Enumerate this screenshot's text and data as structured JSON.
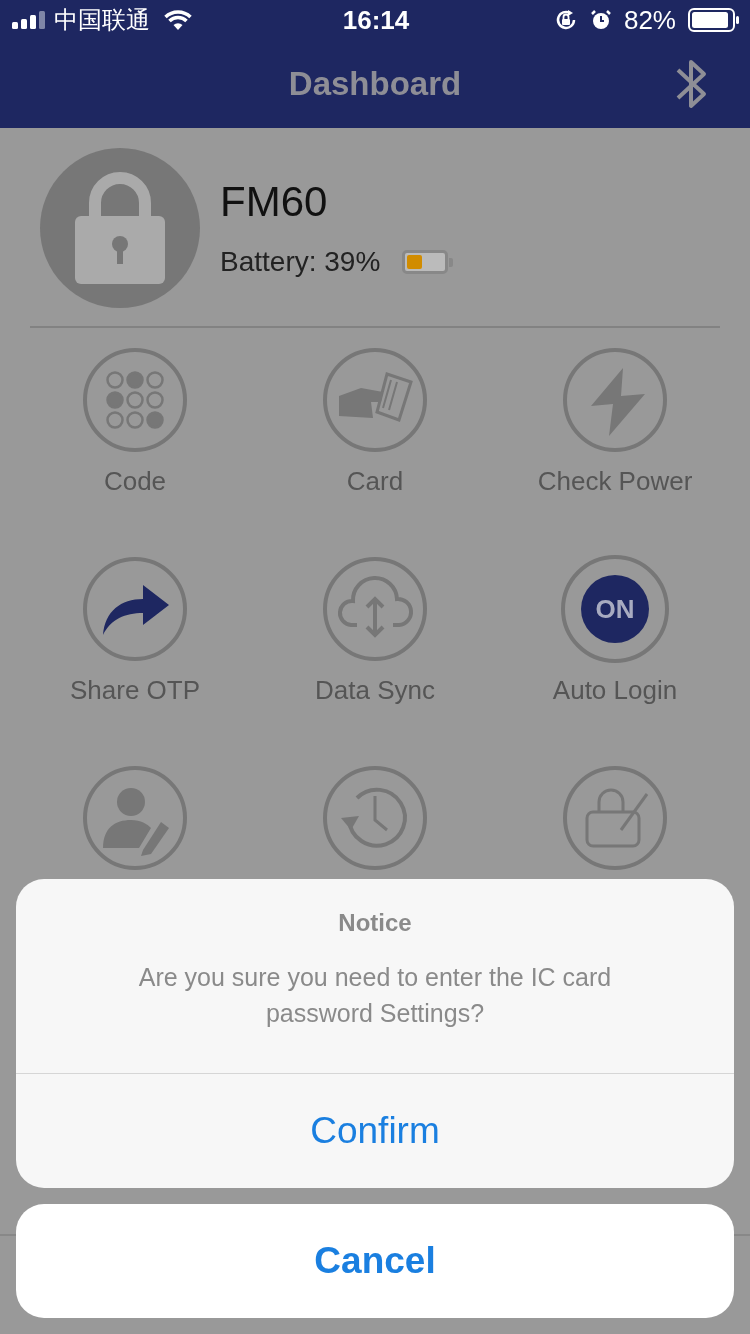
{
  "status_bar": {
    "carrier": "中国联通",
    "time": "16:14",
    "battery": "82%"
  },
  "header": {
    "title": "Dashboard"
  },
  "device": {
    "name": "FM60",
    "battery": "Battery: 39%"
  },
  "tiles": [
    {
      "kind": "code",
      "label": "Code"
    },
    {
      "kind": "card",
      "label": "Card"
    },
    {
      "kind": "power",
      "label": "Check Power"
    },
    {
      "kind": "share",
      "label": "Share OTP"
    },
    {
      "kind": "sync",
      "label": "Data Sync"
    },
    {
      "kind": "on",
      "label": "Auto Login",
      "badge": "ON"
    },
    {
      "kind": "user"
    },
    {
      "kind": "history"
    },
    {
      "kind": "password"
    }
  ],
  "dialog": {
    "title": "Notice",
    "message": "Are you sure you need to enter the IC card password Settings?",
    "confirm": "Confirm",
    "cancel": "Cancel"
  }
}
